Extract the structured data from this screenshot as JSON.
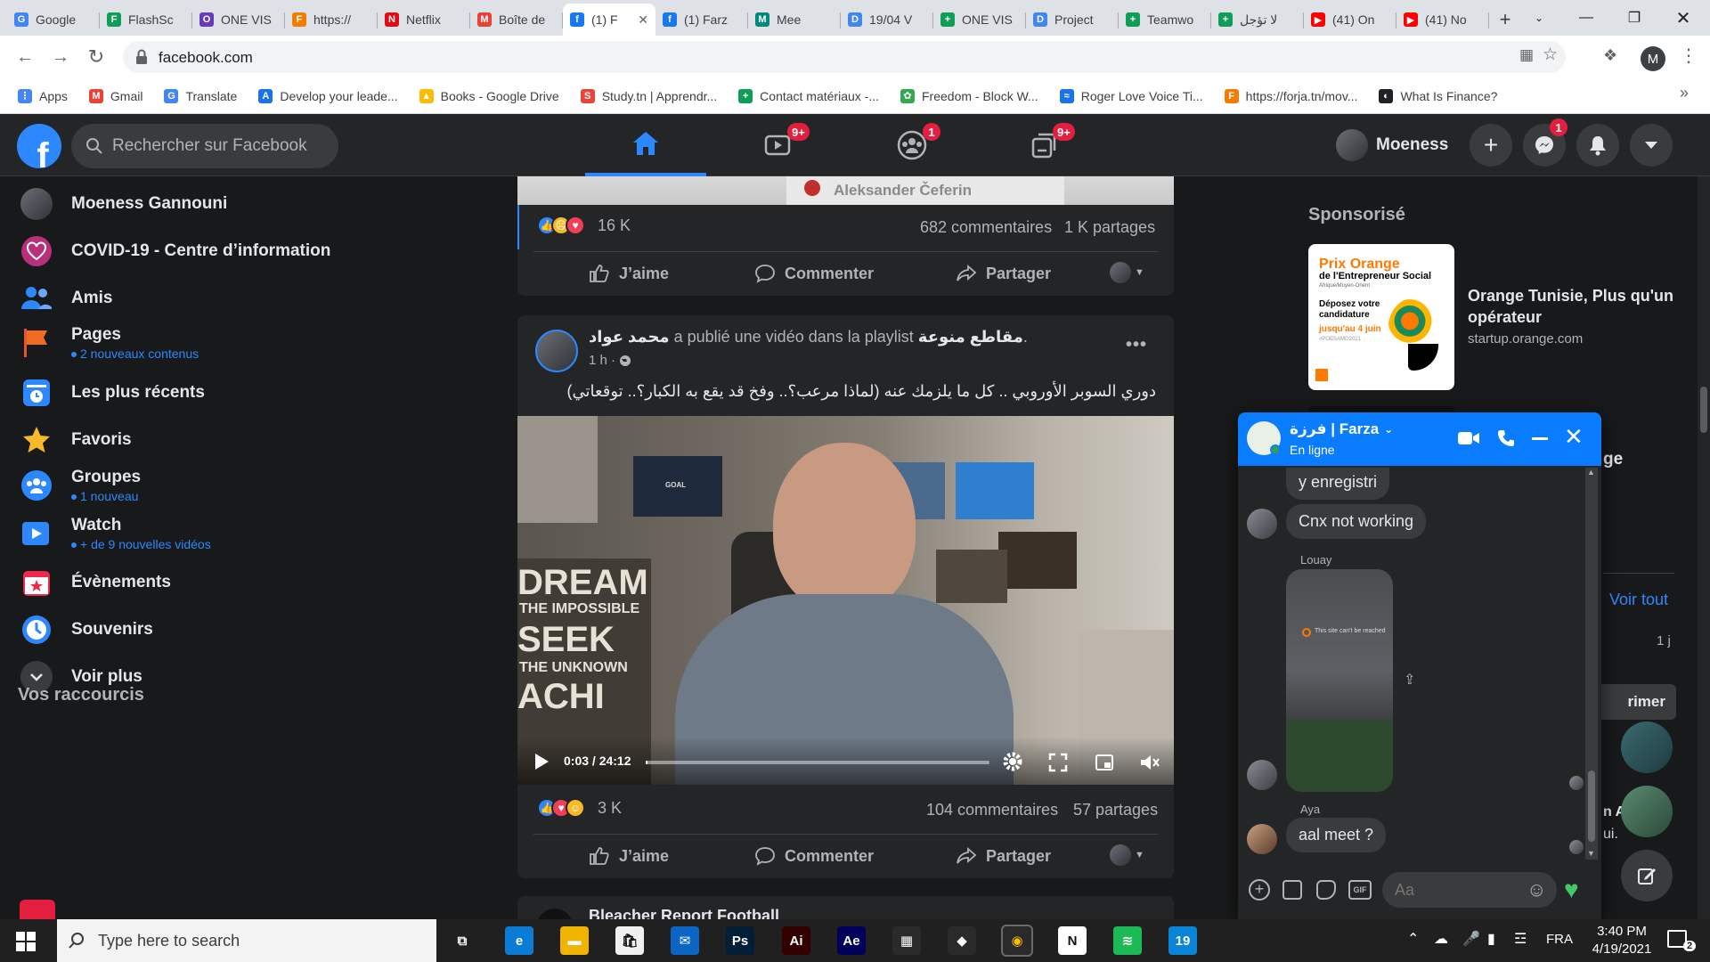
{
  "browser": {
    "tabs": [
      {
        "title": "Google",
        "color": "#4285f4",
        "glyph": "G"
      },
      {
        "title": "FlashSc",
        "color": "#0f9d58",
        "glyph": "F"
      },
      {
        "title": "ONE VIS",
        "color": "#673ab7",
        "glyph": "O"
      },
      {
        "title": "https://",
        "color": "#f57c00",
        "glyph": "F"
      },
      {
        "title": "Netflix",
        "color": "#e50914",
        "glyph": "N"
      },
      {
        "title": "Boîte de",
        "color": "#ea4335",
        "glyph": "M"
      },
      {
        "title": "(1) F",
        "color": "#1877f2",
        "glyph": "f",
        "active": true
      },
      {
        "title": "(1) Farz",
        "color": "#1877f2",
        "glyph": "f"
      },
      {
        "title": "Mee",
        "color": "#00897b",
        "glyph": "M"
      },
      {
        "title": "19/04 V",
        "color": "#4285f4",
        "glyph": "D"
      },
      {
        "title": "ONE VIS",
        "color": "#0f9d58",
        "glyph": "+"
      },
      {
        "title": "Project",
        "color": "#4285f4",
        "glyph": "D"
      },
      {
        "title": "Teamwo",
        "color": "#0f9d58",
        "glyph": "+"
      },
      {
        "title": "لا تؤجل",
        "color": "#0f9d58",
        "glyph": "+"
      },
      {
        "title": "(41) On",
        "color": "#ff0000",
        "glyph": "▶"
      },
      {
        "title": "(41) No",
        "color": "#ff0000",
        "glyph": "▶"
      }
    ],
    "new_tab_label": "+",
    "url": "facebook.com",
    "profile_initial": "M",
    "bookmarks": [
      {
        "label": "Apps",
        "color": "#4285f4",
        "glyph": "⋮"
      },
      {
        "label": "Gmail",
        "color": "#ea4335",
        "glyph": "M"
      },
      {
        "label": "Translate",
        "color": "#4285f4",
        "glyph": "G"
      },
      {
        "label": "Develop your leade...",
        "color": "#1a73e8",
        "glyph": "A"
      },
      {
        "label": "Books - Google Drive",
        "color": "#fbbc04",
        "glyph": "▲"
      },
      {
        "label": "Study.tn | Apprendr...",
        "color": "#e8453c",
        "glyph": "S"
      },
      {
        "label": "Contact matériaux -...",
        "color": "#0f9d58",
        "glyph": "+"
      },
      {
        "label": "Freedom - Block W...",
        "color": "#34a853",
        "glyph": "✿"
      },
      {
        "label": "Roger Love Voice Ti...",
        "color": "#1a73e8",
        "glyph": "≈"
      },
      {
        "label": "https://forja.tn/mov...",
        "color": "#f57c00",
        "glyph": "F"
      },
      {
        "label": "What Is Finance?",
        "color": "#202124",
        "glyph": "◐"
      }
    ],
    "bookmarks_more": "»"
  },
  "facebook": {
    "search_placeholder": "Rechercher sur Facebook",
    "badges": {
      "watch": "9+",
      "groups": "1",
      "gaming": "9+",
      "messenger": "1"
    },
    "profile_name": "Moeness",
    "left_nav": [
      {
        "label": "Moeness Gannouni",
        "sub": "",
        "icon": "profile-avatar"
      },
      {
        "label": "COVID-19 - Centre d’information",
        "sub": "",
        "icon": "covid-heart-icon"
      },
      {
        "label": "Amis",
        "sub": "",
        "icon": "friends-icon"
      },
      {
        "label": "Pages",
        "sub": "2 nouveaux contenus",
        "icon": "flag-icon"
      },
      {
        "label": "Les plus récents",
        "sub": "",
        "icon": "clock-feed-icon"
      },
      {
        "label": "Favoris",
        "sub": "",
        "icon": "star-icon"
      },
      {
        "label": "Groupes",
        "sub": "1 nouveau",
        "icon": "groups-icon"
      },
      {
        "label": "Watch",
        "sub": "+ de 9 nouvelles vidéos",
        "icon": "watch-icon"
      },
      {
        "label": "Évènements",
        "sub": "",
        "icon": "calendar-icon"
      },
      {
        "label": "Souvenirs",
        "sub": "",
        "icon": "memories-icon"
      },
      {
        "label": "Voir plus",
        "sub": "",
        "icon": "chevron-down-icon"
      }
    ],
    "shortcuts_heading": "Vos raccourcis",
    "post1": {
      "image_caption": "Aleksander Čeferin",
      "reactions_count": "16 K",
      "comments": "682 commentaires",
      "shares": "1 K partages"
    },
    "actions": {
      "like": "J’aime",
      "comment": "Commenter",
      "share": "Partager"
    },
    "post2": {
      "author": "محمد عواد",
      "action_text": "a publié une vidéo dans la playlist",
      "playlist": "مقاطع منوعة",
      "dot": ".",
      "time": "1 h ·",
      "text": "دوري السوبر الأوروبي .. كل ما يلزمك عنه (لماذا مرعب؟.. وفخ قد يقع به الكبار؟.. توقعاتي)",
      "video_time": "0:03 / 24:12",
      "video_progress": 0.002,
      "wall_text": [
        "DREAM",
        "THE IMPOSSIBLE",
        "SEEK",
        "THE UNKNOWN",
        "ACHI"
      ],
      "poster_text": "GOAL",
      "reactions_count": "3 K",
      "comments": "104 commentaires",
      "shares": "57 partages"
    },
    "post3_author": "Bleacher Report Football",
    "sponsored": {
      "heading": "Sponsorisé",
      "ad_title": "Orange Tunisie, Plus qu'un opérateur",
      "ad_domain": "startup.orange.com",
      "ad_image_title": "Prix Orange",
      "ad_image_sub": "de l'Entrepreneur Social",
      "ad_image_small": "Afrique/Moyen-Orient",
      "ad_image_body": "Déposez votre candidature",
      "ad_image_date": "jusqu'au 4 juin",
      "ad_image_tag": "#POESAMO2021"
    },
    "right_partial": {
      "ge": "ge",
      "voir_tout": "Voir tout",
      "days": "1 j",
      "primer": "rimer",
      "n_a": "n A",
      "ui": "ui."
    }
  },
  "chat": {
    "name": "فرزة | Farza",
    "status": "En ligne",
    "messages": [
      {
        "text": "y enregistri"
      },
      {
        "text": "Cnx not working"
      },
      {
        "sender": "Louay",
        "attachment": "This site can't be reached"
      },
      {
        "sender": "Aya",
        "text": "aal meet ?"
      }
    ],
    "composer_placeholder": "Aa",
    "gif_label": "GIF"
  },
  "taskbar": {
    "search_placeholder": "Type here to search",
    "apps": [
      {
        "name": "task-view",
        "glyph": "⧉",
        "color": "transparent"
      },
      {
        "name": "edge",
        "glyph": "e",
        "color": "#0a7cd6"
      },
      {
        "name": "file-explorer",
        "glyph": "▬",
        "color": "#f0b400"
      },
      {
        "name": "store",
        "glyph": "🛍",
        "color": "#f0f0f0"
      },
      {
        "name": "mail",
        "glyph": "✉",
        "color": "#0a66c2"
      },
      {
        "name": "photoshop",
        "glyph": "Ps",
        "color": "#001e36"
      },
      {
        "name": "illustrator",
        "glyph": "Ai",
        "color": "#330000"
      },
      {
        "name": "after-effects",
        "glyph": "Ae",
        "color": "#00005b"
      },
      {
        "name": "app-colors",
        "glyph": "▦",
        "color": "#2a2a2a"
      },
      {
        "name": "app-red",
        "glyph": "◆",
        "color": "#2a2a2a"
      },
      {
        "name": "chrome",
        "glyph": "◉",
        "color": "#2a2a2a"
      },
      {
        "name": "notion",
        "glyph": "N",
        "color": "#ffffff"
      },
      {
        "name": "spotify",
        "glyph": "≋",
        "color": "#1db954"
      },
      {
        "name": "calendar-19",
        "glyph": "19",
        "color": "#0a84d6"
      }
    ],
    "lang": "FRA",
    "time": "3:40 PM",
    "date": "4/19/2021",
    "notifications": "2"
  }
}
